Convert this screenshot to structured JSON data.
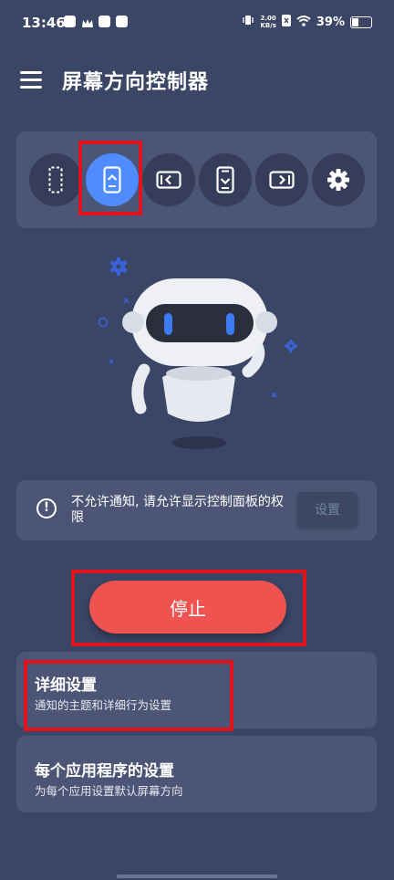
{
  "status": {
    "time": "13:46",
    "speed_value": "2.00",
    "speed_unit": "KB/s",
    "battery": "39%"
  },
  "appbar": {
    "title": "屏幕方向控制器"
  },
  "orientation_buttons": [
    {
      "icon": "screen-off-icon",
      "active": false
    },
    {
      "icon": "auto-rotate-icon",
      "active": true
    },
    {
      "icon": "landscape-left-icon",
      "active": false
    },
    {
      "icon": "portrait-lock-icon",
      "active": false
    },
    {
      "icon": "landscape-right-icon",
      "active": false
    },
    {
      "icon": "gear-icon",
      "active": false
    }
  ],
  "notice": {
    "text": "不允许通知, 请允许显示控制面板的权限",
    "button": "设置"
  },
  "stop_button": "停止",
  "cards": {
    "detail": {
      "title": "详细设置",
      "subtitle": "通知的主题和详细行为设置"
    },
    "per_app": {
      "title": "每个应用程序的设置",
      "subtitle": "为每个应用设置默认屏幕方向"
    }
  },
  "colors": {
    "background": "#3b4566",
    "panel": "#4c5575",
    "accent": "#4e8cff",
    "stop": "#ef5350",
    "highlight": "#e0121b"
  }
}
